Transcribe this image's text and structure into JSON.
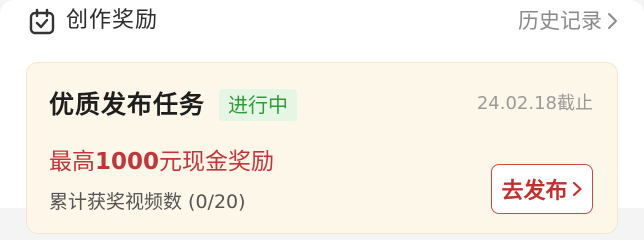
{
  "header": {
    "icon": "calendar-check-icon",
    "title": "创作奖励",
    "history_label": "历史记录"
  },
  "task_card": {
    "title": "优质发布任务",
    "status": "进行中",
    "deadline": "24.02.18截止",
    "reward_prefix": "最高",
    "reward_amount": "1000",
    "reward_suffix": "元现金奖励",
    "progress_text": "累计获奖视频数 (0/20)",
    "button_label": "去发布"
  },
  "colors": {
    "accent": "#c2353a",
    "status_green": "#2e9b3c",
    "card_background": "#fdf7ea"
  }
}
